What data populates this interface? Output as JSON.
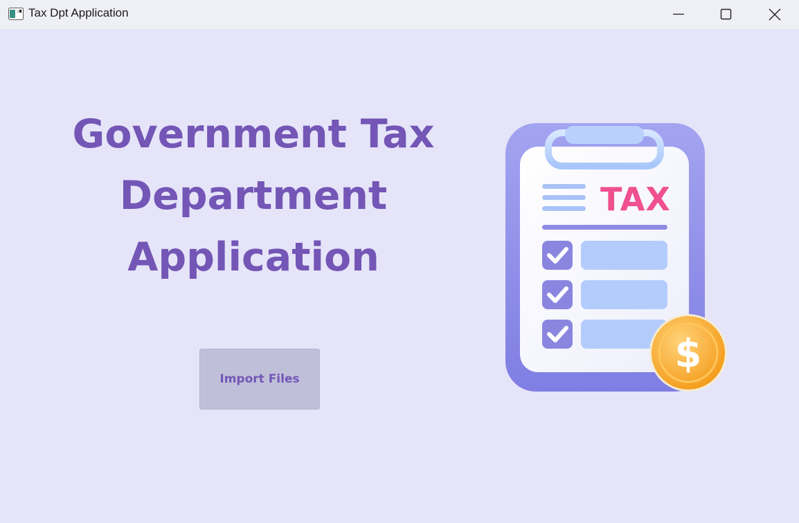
{
  "window": {
    "title": "Tax Dpt Application",
    "icons": [
      "app-icon",
      "minimize-icon",
      "maximize-icon",
      "close-icon"
    ]
  },
  "main": {
    "headline_lines": [
      "Government Tax",
      "Department",
      "Application"
    ],
    "import_button_label": "Import Files",
    "illustration": {
      "tag_text": "TAX",
      "coin_symbol": "$",
      "checklist_items": 3
    }
  },
  "colors": {
    "background": "#e6e4f8",
    "accent": "#7356b6",
    "button_bg": "#c0bfd9",
    "tax_text": "#f0508f",
    "coin": "#f7a920"
  }
}
